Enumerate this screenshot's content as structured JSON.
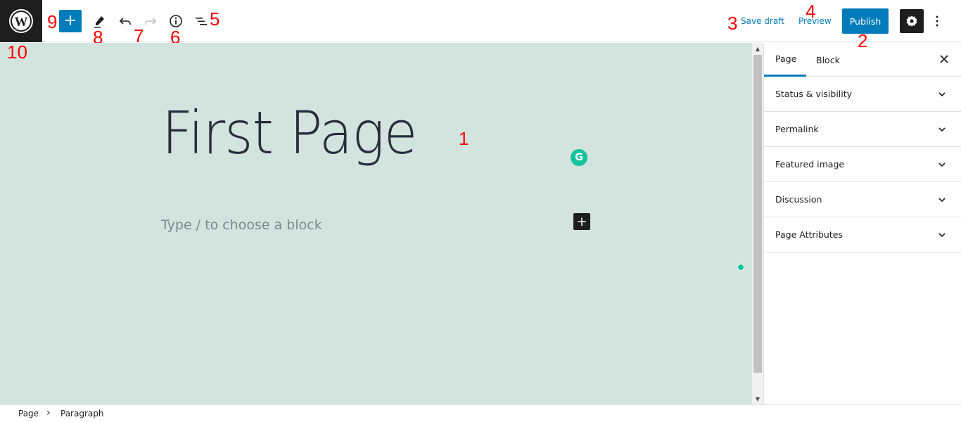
{
  "toolbar": {
    "logo_icon": "wordpress-logo-icon",
    "add_block_label": "+",
    "tools_icon": "pencil-icon",
    "undo_icon": "undo-icon",
    "redo_icon": "redo-icon",
    "details_icon": "info-icon",
    "outline_icon": "list-view-icon",
    "save_draft": "Save draft",
    "preview": "Preview",
    "publish": "Publish",
    "settings_icon": "gear-icon",
    "more_icon": "more-vertical-icon"
  },
  "annotations": {
    "a1": "1",
    "a2": "2",
    "a3": "3",
    "a4": "4",
    "a5": "5",
    "a6": "6",
    "a7": "7",
    "a8": "8",
    "a9": "9",
    "a10": "10"
  },
  "editor": {
    "title": "First Page",
    "placeholder": "Type / to choose a block",
    "inline_add_label": "+",
    "grammarly_label": "G"
  },
  "sidebar": {
    "tabs": [
      {
        "label": "Page",
        "active": true
      },
      {
        "label": "Block",
        "active": false
      }
    ],
    "close_icon": "close-icon",
    "panels": [
      {
        "label": "Status & visibility"
      },
      {
        "label": "Permalink"
      },
      {
        "label": "Featured image"
      },
      {
        "label": "Discussion"
      },
      {
        "label": "Page Attributes"
      }
    ]
  },
  "footer": {
    "breadcrumb": [
      "Page",
      "Paragraph"
    ],
    "separator": "›"
  },
  "colors": {
    "accent": "#007cba",
    "dark": "#1e1e1e",
    "canvas_bg": "#d3e4df",
    "grammarly": "#15c39a",
    "annotation": "#ff0000"
  }
}
